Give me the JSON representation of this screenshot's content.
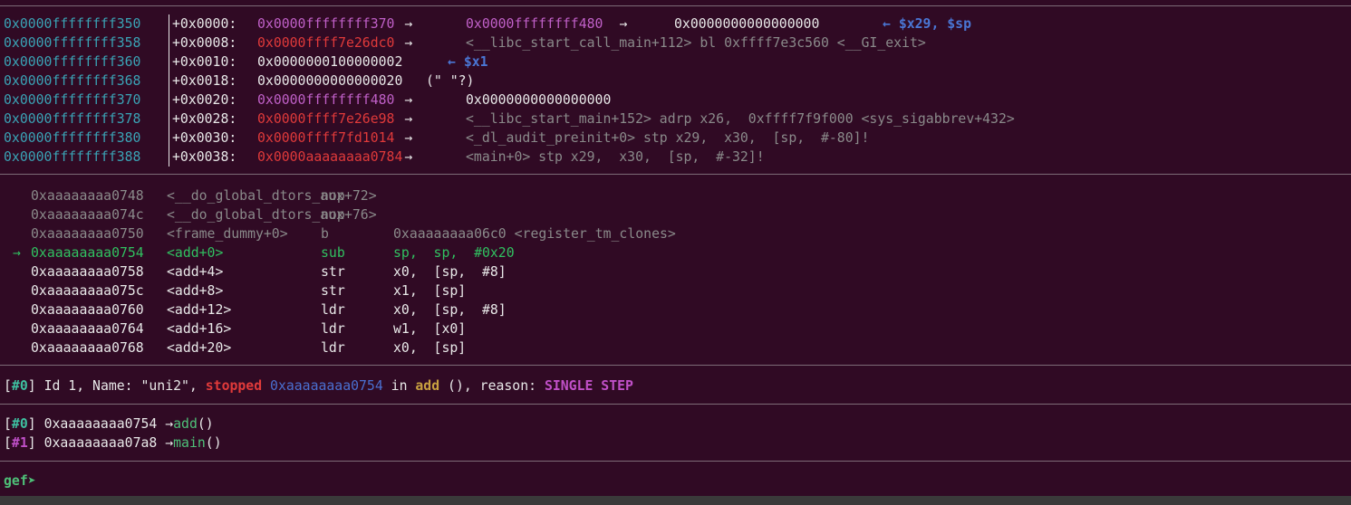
{
  "stack": [
    {
      "addr": "0x0000ffffffff350",
      "off": "+0x0000:",
      "val": "0x0000ffffffff370",
      "val_color": "purple",
      "a1": " → ",
      "ptr": "0x0000ffffffff480",
      "a2": "  →  ",
      "tail": "0x0000000000000000",
      "tail_color": "white",
      "note": "← $x29, $sp"
    },
    {
      "addr": "0x0000ffffffff358",
      "off": "+0x0008:",
      "val": "0x0000ffff7e26dc0",
      "val_color": "red",
      "a1": " → ",
      "ptr": "",
      "a2": "",
      "tail": "<__libc_start_call_main+112> bl 0xffff7e3c560 <__GI_exit>",
      "tail_color": "grey",
      "note": ""
    },
    {
      "addr": "0x0000ffffffff360",
      "off": "+0x0010:",
      "val": "0x0000000100000002",
      "val_color": "white",
      "a1": "  ",
      "ptr": "",
      "a2": "",
      "tail": "",
      "tail_color": "white",
      "note": "← $x1"
    },
    {
      "addr": "0x0000ffffffff368",
      "off": "+0x0018:",
      "val": "0x0000000000000020",
      "val_color": "white",
      "a1": " ",
      "ptr": "",
      "a2": "",
      "tail": "(\" \"?)",
      "tail_color": "white",
      "note": ""
    },
    {
      "addr": "0x0000ffffffff370",
      "off": "+0x0020:",
      "val": "0x0000ffffffff480",
      "val_color": "purple",
      "a1": " → ",
      "ptr": "",
      "a2": "",
      "tail": "0x0000000000000000",
      "tail_color": "white",
      "note": ""
    },
    {
      "addr": "0x0000ffffffff378",
      "off": "+0x0028:",
      "val": "0x0000ffff7e26e98",
      "val_color": "red",
      "a1": " → ",
      "ptr": "",
      "a2": "",
      "tail": "<__libc_start_main+152> adrp x26,  0xffff7f9f000 <sys_sigabbrev+432>",
      "tail_color": "grey",
      "note": ""
    },
    {
      "addr": "0x0000ffffffff380",
      "off": "+0x0030:",
      "val": "0x0000ffff7fd1014",
      "val_color": "red",
      "a1": " → ",
      "ptr": "",
      "a2": "",
      "tail": "<_dl_audit_preinit+0> stp x29,  x30,  [sp,  #-80]!",
      "tail_color": "grey",
      "note": ""
    },
    {
      "addr": "0x0000ffffffff388",
      "off": "+0x0038:",
      "val": "0x0000aaaaaaaa0784",
      "val_color": "red",
      "a1": " → ",
      "ptr": "",
      "a2": "",
      "tail": "<main+0> stp x29,  x30,  [sp,  #-32]!",
      "tail_color": "grey",
      "note": ""
    }
  ],
  "code": [
    {
      "mark": " ",
      "addr": "0xaaaaaaaa0748",
      "sym": "<__do_global_dtors_aux+72>",
      "mn": "nop",
      "ops": "",
      "style": "past"
    },
    {
      "mark": " ",
      "addr": "0xaaaaaaaa074c",
      "sym": "<__do_global_dtors_aux+76>",
      "mn": "nop",
      "ops": "",
      "style": "past"
    },
    {
      "mark": " ",
      "addr": "0xaaaaaaaa0750",
      "sym": "<frame_dummy+0>",
      "mn": "b",
      "ops": "0xaaaaaaaa06c0 <register_tm_clones>",
      "style": "past"
    },
    {
      "mark": "→",
      "addr": "0xaaaaaaaa0754",
      "sym": "<add+0>",
      "mn": "sub",
      "ops": "sp,  sp,  #0x20",
      "style": "current"
    },
    {
      "mark": " ",
      "addr": "0xaaaaaaaa0758",
      "sym": "<add+4>",
      "mn": "str",
      "ops": "x0,  [sp,  #8]",
      "style": "next"
    },
    {
      "mark": " ",
      "addr": "0xaaaaaaaa075c",
      "sym": "<add+8>",
      "mn": "str",
      "ops": "x1,  [sp]",
      "style": "next"
    },
    {
      "mark": " ",
      "addr": "0xaaaaaaaa0760",
      "sym": "<add+12>",
      "mn": "ldr",
      "ops": "x0,  [sp,  #8]",
      "style": "next"
    },
    {
      "mark": " ",
      "addr": "0xaaaaaaaa0764",
      "sym": "<add+16>",
      "mn": "ldr",
      "ops": "w1,  [x0]",
      "style": "next"
    },
    {
      "mark": " ",
      "addr": "0xaaaaaaaa0768",
      "sym": "<add+20>",
      "mn": "ldr",
      "ops": "x0,  [sp]",
      "style": "next"
    }
  ],
  "thread": {
    "lb": "[",
    "idx": "#0",
    "rb": "]",
    "p1": " Id 1, Name: \"uni2\", ",
    "state": "stopped",
    "p2": " ",
    "pc": "0xaaaaaaaa0754",
    "p3": " in ",
    "fn": "add",
    "p4": " (), reason: ",
    "reason": "SINGLE STEP"
  },
  "trace": [
    {
      "idx": "#0",
      "addr": "0xaaaaaaaa0754",
      "arrow": "→",
      "fn": "add",
      "paren": "()"
    },
    {
      "idx": "#1",
      "addr": "0xaaaaaaaa07a8",
      "arrow": "→",
      "fn": "main",
      "paren": "()"
    }
  ],
  "prompt": {
    "label": "gef",
    "arrow": "➤"
  },
  "colors": {
    "bg": "#300a24",
    "addr": "#3aa3b5",
    "heap": "#c060c8",
    "code_ptr": "#e03a3a",
    "current": "#30c060"
  }
}
